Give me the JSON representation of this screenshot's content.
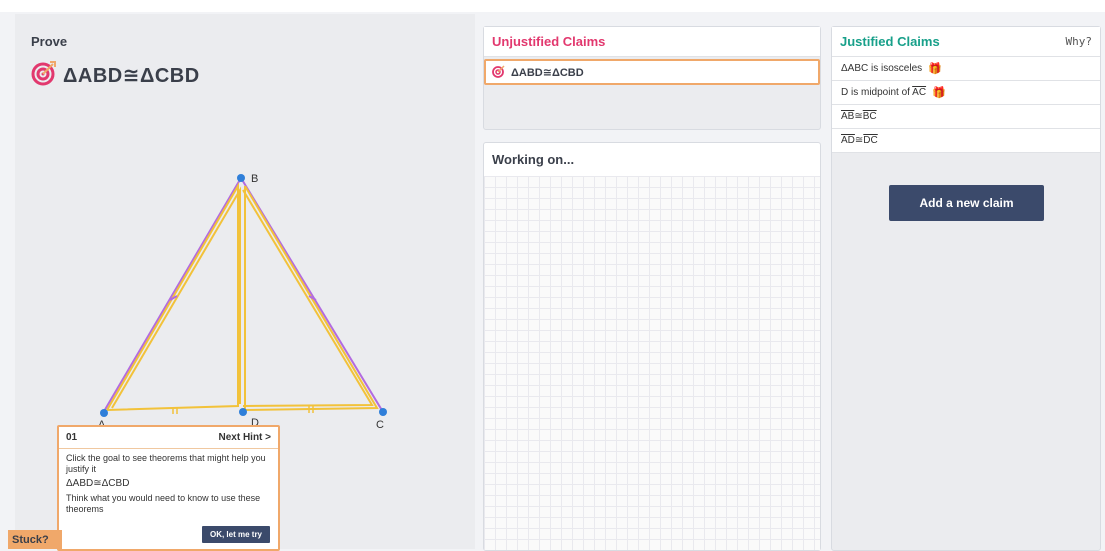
{
  "prove": {
    "title": "Prove",
    "goal": "ΔABD≅ΔCBD"
  },
  "figure": {
    "labels": {
      "A": "A",
      "B": "B",
      "C": "C",
      "D": "D"
    }
  },
  "unjustified": {
    "title": "Unjustified Claims",
    "items": [
      {
        "text": "ΔABD≅ΔCBD",
        "icon": "target-icon"
      }
    ]
  },
  "working": {
    "title": "Working on..."
  },
  "justified": {
    "title": "Justified Claims",
    "why_label": "Why?",
    "claims": [
      {
        "text": "ΔABC is isosceles",
        "icon": "gift-icon"
      },
      {
        "prefix": "D is midpoint of ",
        "seg": "AC",
        "icon": "gift-icon"
      },
      {
        "seg1": "AB",
        "rel": "≅",
        "seg2": "BC"
      },
      {
        "seg1": "AD",
        "rel": "≅",
        "seg2": "DC"
      }
    ],
    "add_button": "Add a new claim"
  },
  "hint": {
    "number": "01",
    "next_label": "Next Hint >",
    "text1": "Click the goal to see theorems that might help you justify it",
    "goal": "ΔABD≅ΔCBD",
    "text2": "Think what you would need to know to use these theorems",
    "ok_button": "OK, let me try"
  },
  "stuck": {
    "label": "Stuck?"
  },
  "colors": {
    "accent_orange": "#f0a86a",
    "unjustified": "#e2386e",
    "justified": "#18a08a",
    "button": "#3b4a6b",
    "purple": "#b26be0",
    "yellow": "#f2c23a",
    "point": "#2f7fd9"
  }
}
